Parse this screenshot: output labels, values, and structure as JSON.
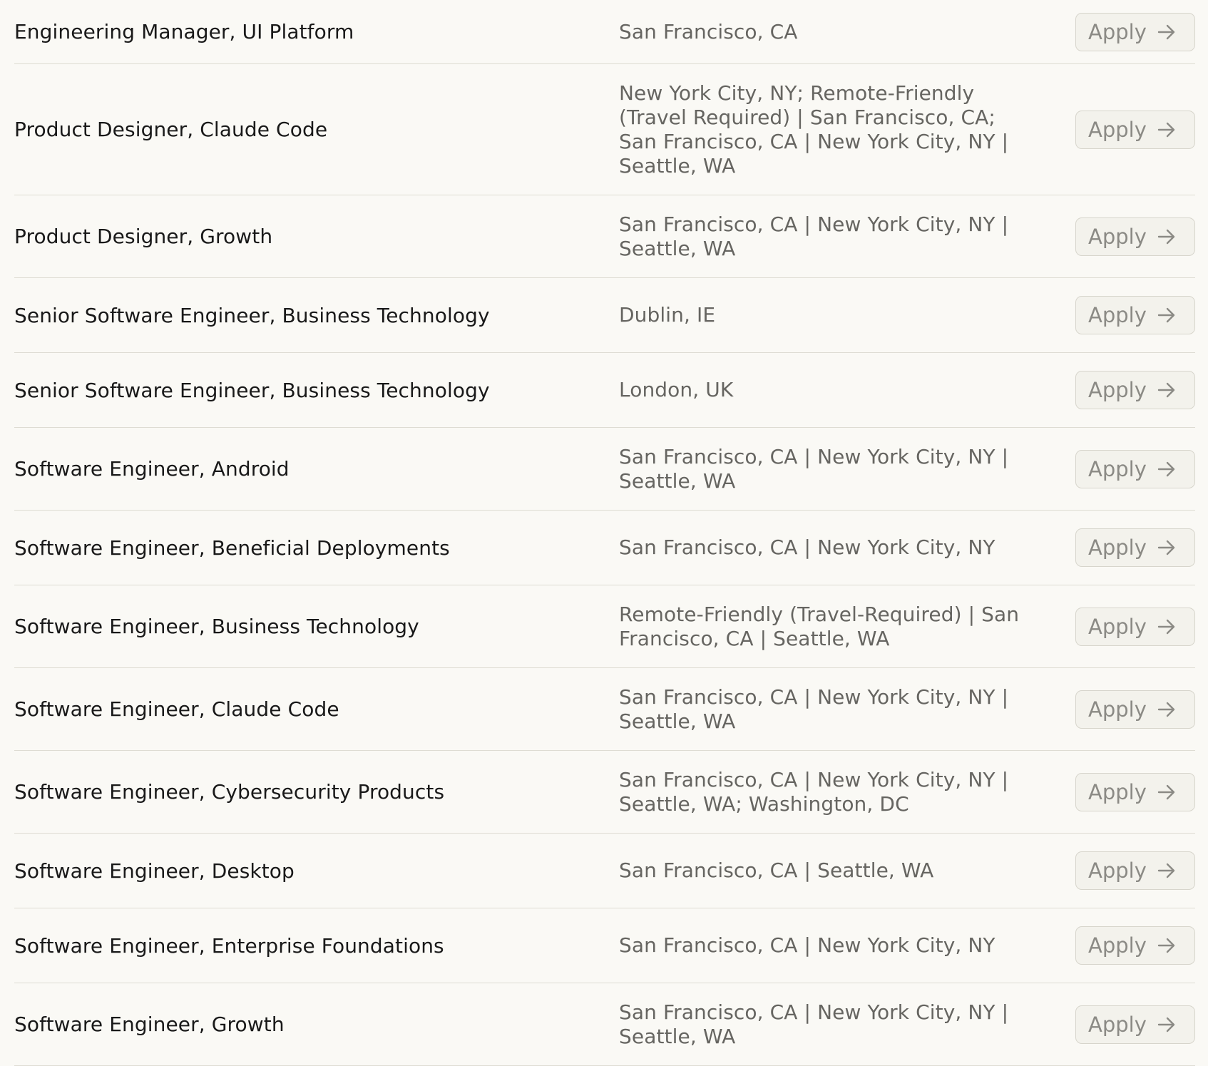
{
  "jobs": [
    {
      "title": "Engineering Manager, UI Platform",
      "location": "San Francisco, CA",
      "apply_label": "Apply",
      "arrow_icon": "arrow-right-icon"
    },
    {
      "title": "Product Designer, Claude Code",
      "location": "New York City, NY; Remote-Friendly (Travel Required) | San Francisco, CA; San Francisco, CA | New York City, NY | Seattle, WA",
      "apply_label": "Apply",
      "arrow_icon": "arrow-right-icon"
    },
    {
      "title": "Product Designer, Growth",
      "location": "San Francisco, CA | New York City, NY | Seattle, WA",
      "apply_label": "Apply",
      "arrow_icon": "arrow-right-icon"
    },
    {
      "title": "Senior Software Engineer, Business Technology",
      "location": "Dublin, IE",
      "apply_label": "Apply",
      "arrow_icon": "arrow-right-icon"
    },
    {
      "title": "Senior Software Engineer, Business Technology",
      "location": "London, UK",
      "apply_label": "Apply",
      "arrow_icon": "arrow-right-icon"
    },
    {
      "title": "Software Engineer, Android",
      "location": "San Francisco, CA | New York City, NY | Seattle, WA",
      "apply_label": "Apply",
      "arrow_icon": "arrow-right-icon"
    },
    {
      "title": "Software Engineer, Beneficial Deployments",
      "location": "San Francisco, CA | New York City, NY",
      "apply_label": "Apply",
      "arrow_icon": "arrow-right-icon"
    },
    {
      "title": "Software Engineer, Business Technology",
      "location": "Remote-Friendly (Travel-Required) | San Francisco, CA | Seattle, WA",
      "apply_label": "Apply",
      "arrow_icon": "arrow-right-icon"
    },
    {
      "title": "Software Engineer, Claude Code",
      "location": "San Francisco, CA | New York City, NY | Seattle, WA",
      "apply_label": "Apply",
      "arrow_icon": "arrow-right-icon"
    },
    {
      "title": "Software Engineer, Cybersecurity Products",
      "location": "San Francisco, CA | New York City, NY | Seattle, WA; Washington, DC",
      "apply_label": "Apply",
      "arrow_icon": "arrow-right-icon"
    },
    {
      "title": "Software Engineer, Desktop",
      "location": "San Francisco, CA | Seattle, WA",
      "apply_label": "Apply",
      "arrow_icon": "arrow-right-icon"
    },
    {
      "title": "Software Engineer, Enterprise Foundations",
      "location": "San Francisco, CA | New York City, NY",
      "apply_label": "Apply",
      "arrow_icon": "arrow-right-icon"
    },
    {
      "title": "Software Engineer, Growth",
      "location": "San Francisco, CA | New York City, NY | Seattle, WA",
      "apply_label": "Apply",
      "arrow_icon": "arrow-right-icon"
    }
  ]
}
